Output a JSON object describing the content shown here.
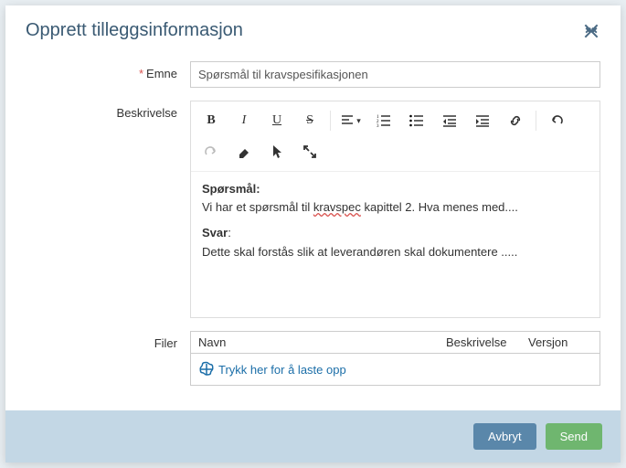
{
  "modal": {
    "title": "Opprett tilleggsinformasjon"
  },
  "form": {
    "subject_label": "Emne",
    "subject_value": "Spørsmål til kravspesifikasjonen",
    "description_label": "Beskrivelse",
    "files_label": "Filer"
  },
  "editor": {
    "q_label": "Spørsmål:",
    "q_text_pre": "Vi har et spørsmål til ",
    "q_text_word": "kravspec",
    "q_text_post": " kapittel 2. Hva menes med....",
    "a_label": "Svar",
    "a_text": "Dette skal forstås slik at leverandøren skal dokumentere ....."
  },
  "file_table": {
    "col_name": "Navn",
    "col_desc": "Beskrivelse",
    "col_ver": "Versjon",
    "upload_text": "Trykk her for å laste opp"
  },
  "footer": {
    "cancel": "Avbryt",
    "send": "Send"
  }
}
